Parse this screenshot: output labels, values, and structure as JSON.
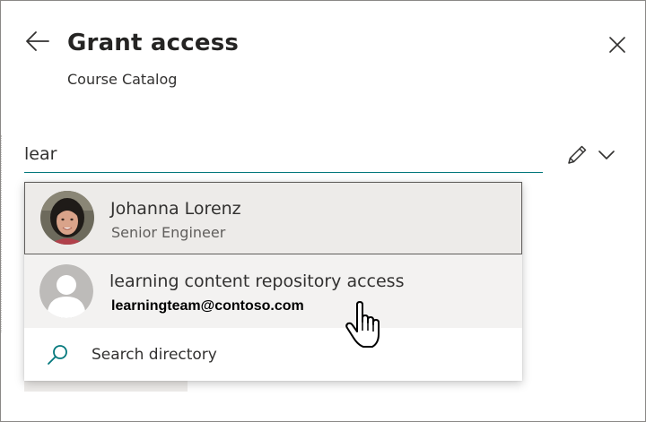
{
  "panel": {
    "title": "Grant access",
    "subtitle": "Course Catalog"
  },
  "search": {
    "value": "lear"
  },
  "suggestions": [
    {
      "name": "Johanna Lorenz",
      "secondary": "Senior Engineer",
      "avatar": "photo"
    },
    {
      "name": "learning content repository access",
      "secondary": "learningteam@contoso.com",
      "avatar": "default-person"
    }
  ],
  "search_directory": {
    "label": "Search directory"
  },
  "icons": {
    "back": "back-arrow-icon",
    "close": "close-icon",
    "edit": "pencil-icon",
    "expand": "chevron-down-icon",
    "search": "search-icon",
    "cursor": "hand-pointer-cursor"
  },
  "colors": {
    "accent": "#03787c",
    "text": "#323130",
    "highlight": "#edebe9"
  }
}
